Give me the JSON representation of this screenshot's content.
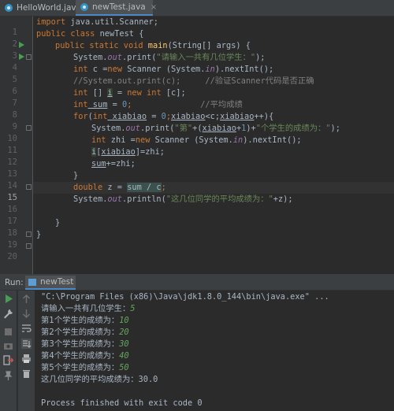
{
  "tabs": [
    {
      "label": "HelloWorld.java",
      "close": "×",
      "icon": "java-class-icon"
    },
    {
      "label": "newTest.java",
      "close": "×",
      "icon": "java-class-icon"
    }
  ],
  "editor": {
    "line_numbers": [
      "1",
      "2",
      "3",
      "4",
      "5",
      "6",
      "7",
      "8",
      "9",
      "10",
      "11",
      "12",
      "13",
      "14",
      "15",
      "16",
      "17",
      "18",
      "19",
      "20"
    ],
    "current_line": 15,
    "lines": {
      "l1_a": "import",
      "l1_b": " java.util.Scanner;",
      "l2_a": "public class",
      "l2_b": " newTest {",
      "l3_a": "public static void",
      "l3_b": "main",
      "l3_c": "(String[] args) {",
      "l4_a": "System.",
      "l4_b": "out",
      "l4_c": ".print(",
      "l4_d": "\"请输入一共有几位学生：\"",
      "l4_e": ");",
      "l5_a": "int",
      "l5_b": " c =",
      "l5_c": "new",
      "l5_d": " Scanner (System.",
      "l5_e": "in",
      "l5_f": ").nextInt();",
      "l6_a": "//System.out.print(c);",
      "l6_b": "     //验证Scanner代码是否正确",
      "l7_a": "int",
      "l7_b": " [] ",
      "l7_c": "i",
      "l7_d": " = ",
      "l7_e": "new",
      "l7_f": " ",
      "l7_g": "int",
      "l7_h": " [c];",
      "l8_a": "int",
      "l8_b": " sum",
      "l8_c": " = ",
      "l8_d": "0",
      "l8_e": ";",
      "l8_f": "              //平均成绩",
      "l9_a": "for",
      "l9_b": "(",
      "l9_c": "int",
      "l9_d": " xiabiao",
      "l9_e": " = ",
      "l9_f": "0",
      "l9_g": ";",
      "l9_h": "xiabiao",
      "l9_i": "<c;",
      "l9_j": "xiabiao",
      "l9_k": "++){",
      "l10_a": "System.",
      "l10_b": "out",
      "l10_c": ".print(",
      "l10_d": "\"第\"",
      "l10_e": "+(",
      "l10_f": "xiabiao",
      "l10_g": "+",
      "l10_h": "1",
      "l10_i": ")+",
      "l10_j": "\"个学生的成绩为：\"",
      "l10_k": ");",
      "l11_a": "int",
      "l11_b": " zhi =",
      "l11_c": "new",
      "l11_d": " Scanner (System.",
      "l11_e": "in",
      "l11_f": ").nextInt();",
      "l12_a": "i",
      "l12_b": "[",
      "l12_c": "xiabiao",
      "l12_d": "]=zhi;",
      "l13_a": "sum",
      "l13_b": "+=zhi;",
      "l14_a": "}",
      "l15_a": "double",
      "l15_b": " z = ",
      "l15_c": "sum / c",
      "l15_d": ";",
      "l16_a": "System.",
      "l16_b": "out",
      "l16_c": ".println(",
      "l16_d": "\"这几位同学的平均成绩为：\"",
      "l16_e": "+z);",
      "l18_a": "}",
      "l19_a": "}"
    }
  },
  "run": {
    "label": "Run:",
    "tab_label": "newTest",
    "output": {
      "cmd": "\"C:\\Program Files (x86)\\Java\\jdk1.8.0_144\\bin\\java.exe\" ...",
      "o1_a": "请输入一共有几位学生：",
      "o1_b": "5",
      "o2_a": "第1个学生的成绩为：",
      "o2_b": "10",
      "o3_a": "第2个学生的成绩为：",
      "o3_b": "20",
      "o4_a": "第3个学生的成绩为：",
      "o4_b": "30",
      "o5_a": "第4个学生的成绩为：",
      "o5_b": "40",
      "o6_a": "第5个学生的成绩为：",
      "o6_b": "50",
      "o7": "这几位同学的平均成绩为：30.0",
      "exit": "Process finished with exit code 0"
    },
    "tool_icons": [
      "rerun-icon",
      "wrench-icon",
      "stop-icon",
      "camera-icon",
      "exit-icon",
      "pin-icon",
      "up-arrow-icon",
      "down-arrow-icon",
      "soft-wrap-icon",
      "scroll-to-end-icon",
      "print-icon",
      "trash-icon"
    ]
  },
  "colors": {
    "keyword": "#cc7832",
    "string": "#6a8759",
    "comment": "#808080",
    "field": "#9876aa",
    "method": "#ffc66d",
    "number": "#6897bb",
    "run_green": "#499c54",
    "input_value": "#62a85c"
  }
}
